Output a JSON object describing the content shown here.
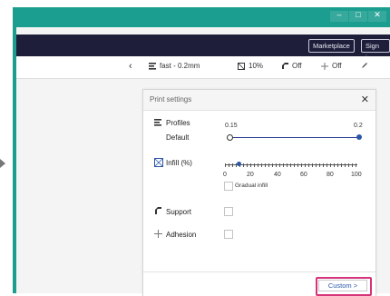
{
  "window": {
    "controls": [
      "minimize",
      "maximize",
      "close"
    ]
  },
  "header": {
    "buttons": {
      "marketplace": "Marketplace",
      "signin": "Sign in"
    }
  },
  "toolbar": {
    "profile": "fast - 0.2mm",
    "infill": "10%",
    "support": "Off",
    "adhesion": "Off"
  },
  "panel": {
    "title": "Print settings",
    "profiles": {
      "label": "Profiles",
      "sublabel": "Default",
      "min_label": "0.15",
      "max_label": "0.2",
      "value_fraction": 1.0
    },
    "infill": {
      "label": "Infill (%)",
      "ticks": [
        "0",
        "20",
        "40",
        "60",
        "80",
        "100"
      ],
      "value_percent": 10,
      "gradual_label": "Gradual infill"
    },
    "support": {
      "label": "Support"
    },
    "adhesion": {
      "label": "Adhesion"
    },
    "footer": {
      "custom_label": "Custom >"
    }
  },
  "colors": {
    "frame": "#1b9e8f",
    "header": "#1e1e3a",
    "accent": "#2b56a8",
    "highlight": "#d6337a"
  }
}
